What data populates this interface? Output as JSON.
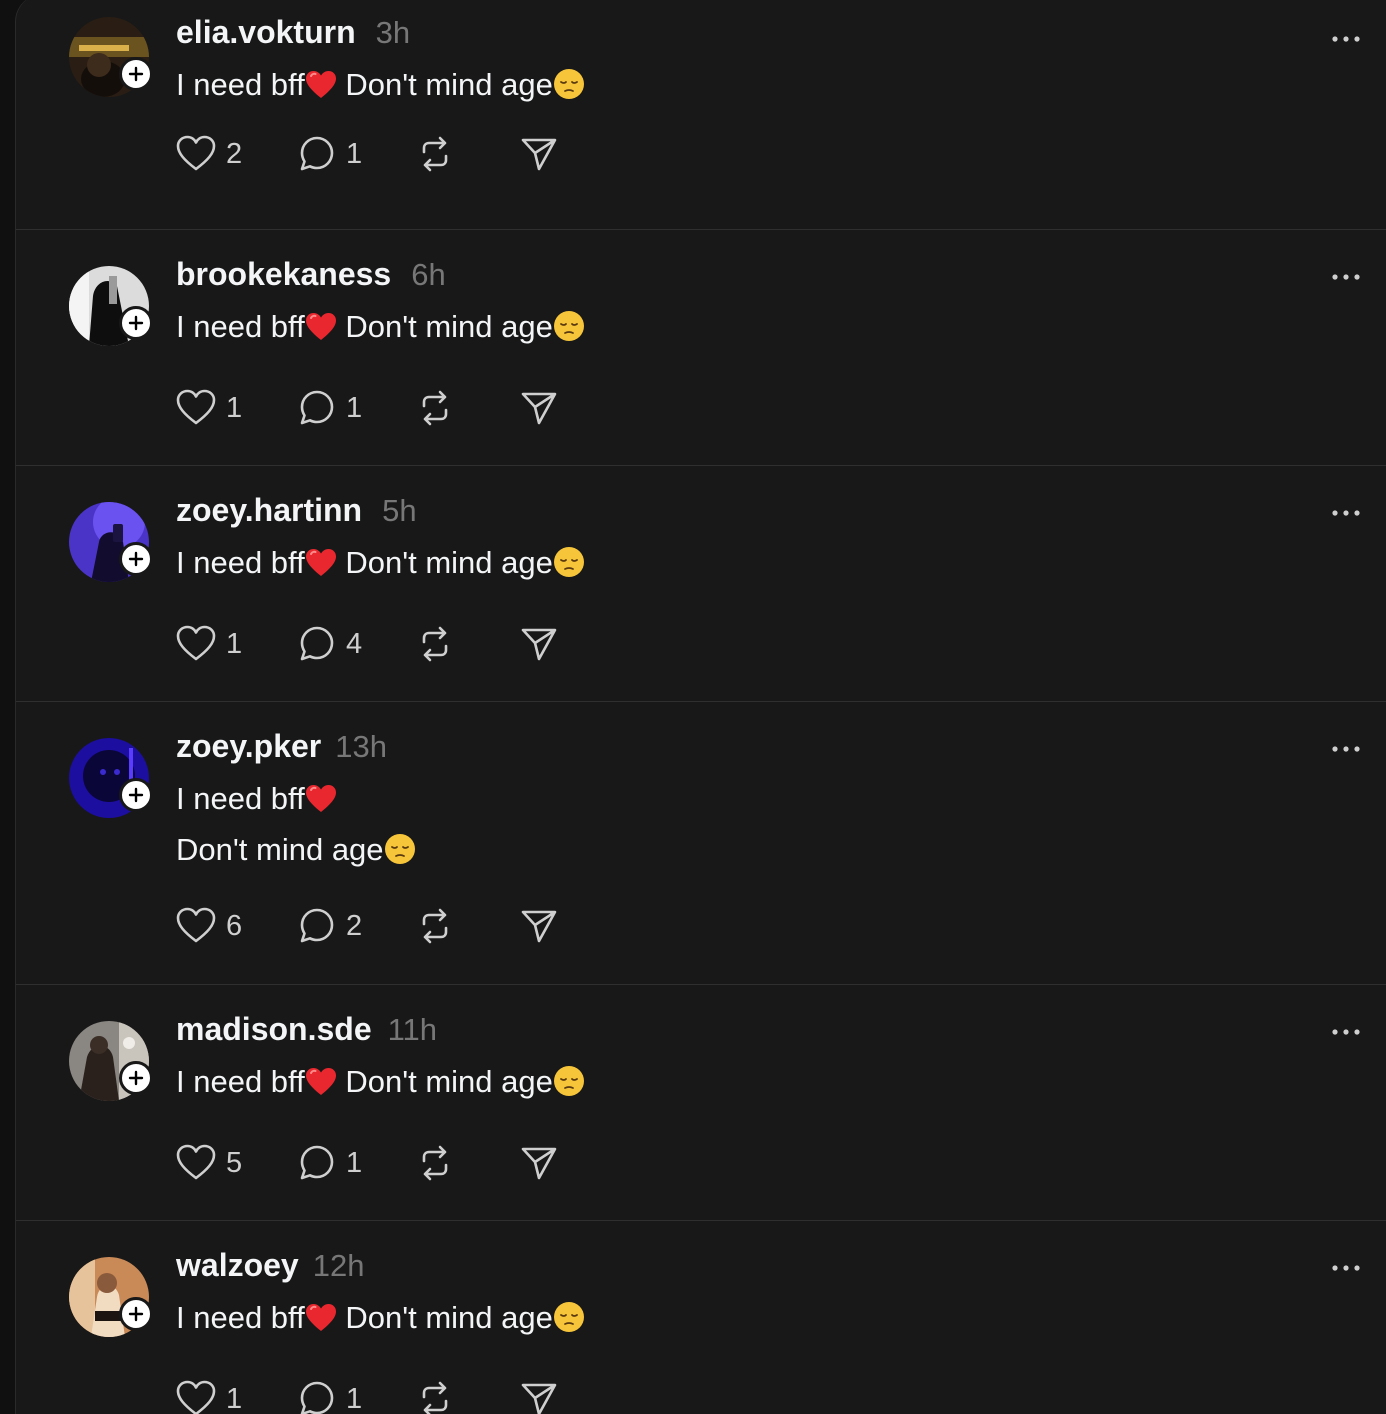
{
  "posts": [
    {
      "username": "elia.vokturn",
      "time": "3h",
      "text": "I need bff",
      "text_after_heart": " Don't mind age",
      "likes": "2",
      "replies": "1",
      "avatar_colors": [
        "#3a2a1a",
        "#c9a23a",
        "#1b1410"
      ]
    },
    {
      "username": "brookekaness",
      "time": "6h",
      "text": "I need bff",
      "text_after_heart": " Don't mind age",
      "likes": "1",
      "replies": "1",
      "avatar_colors": [
        "#e8e8e8",
        "#111111",
        "#9a9a9a"
      ]
    },
    {
      "username": "zoey.hartinn",
      "time": "5h",
      "text": "I need bff",
      "text_after_heart": " Don't mind age",
      "likes": "1",
      "replies": "4",
      "avatar_colors": [
        "#5b3fd6",
        "#1a1240",
        "#2b1f6e"
      ]
    },
    {
      "username": "zoey.pker",
      "time": "13h",
      "text": "I need bff",
      "text_after_heart": "\nDon't mind age",
      "likes": "6",
      "replies": "2",
      "avatar_colors": [
        "#2a14c8",
        "#0c0640",
        "#4b2cff"
      ]
    },
    {
      "username": "madison.sde",
      "time": "11h",
      "text": "I need bff",
      "text_after_heart": " Don't mind age",
      "likes": "5",
      "replies": "1",
      "avatar_colors": [
        "#6e6e6e",
        "#2a211c",
        "#b8b2aa"
      ]
    },
    {
      "username": "walzoey",
      "time": "12h",
      "text": "I need bff",
      "text_after_heart": " Don't mind age",
      "likes": "1",
      "replies": "1",
      "avatar_colors": [
        "#d9a57a",
        "#8a5a3c",
        "#f1d6b8"
      ]
    }
  ],
  "icons": {
    "like": "heart-outline-icon",
    "reply": "speech-bubble-icon",
    "repost": "repost-arrows-icon",
    "share": "paper-plane-icon",
    "more": "ellipsis-icon",
    "follow": "plus-icon"
  },
  "colors": {
    "background": "#181818",
    "text": "#f3f5f7",
    "muted": "#777777",
    "divider": "#2f2f2f"
  }
}
